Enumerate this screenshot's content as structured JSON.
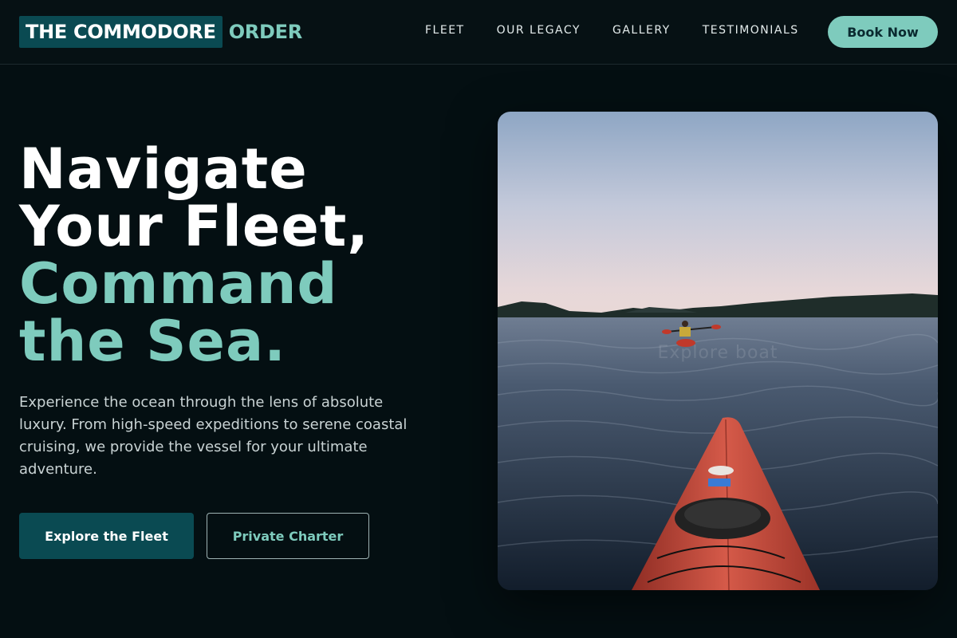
{
  "brand": {
    "badge": "THE COMMODORE",
    "accent": "ORDER"
  },
  "nav": {
    "items": [
      {
        "label": "FLEET"
      },
      {
        "label": "OUR LEGACY"
      },
      {
        "label": "GALLERY"
      },
      {
        "label": "TESTIMONIALS"
      }
    ]
  },
  "header": {
    "book_label": "Book Now"
  },
  "hero": {
    "title_line_1": "Navigate",
    "title_line_2": "Your Fleet,",
    "title_line_3": "Command",
    "title_line_4": "the Sea.",
    "description": "Experience the ocean through the lens of absolute luxury. From high-speed expeditions to serene coastal cruising, we provide the vessel for your ultimate adventure.",
    "primary_cta": "Explore the Fleet",
    "secondary_cta": "Private Charter",
    "image_watermark": "Explore boat"
  },
  "colors": {
    "background": "#040f12",
    "accent": "#7ecbbd",
    "brand_dark": "#0a4a52"
  },
  "icons": {
    "hero_image": "kayak-on-lake-photo"
  }
}
